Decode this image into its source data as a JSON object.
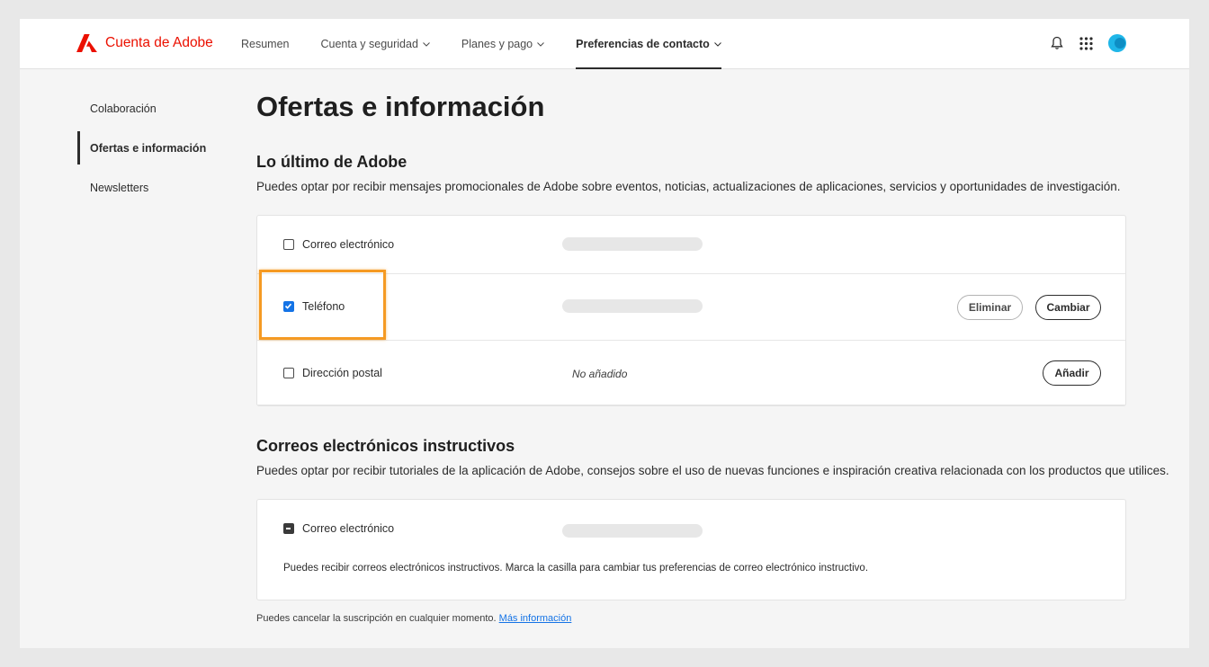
{
  "header": {
    "brand": "Cuenta de Adobe",
    "brand_color": "#eb1000",
    "nav": [
      {
        "label": "Resumen",
        "has_dropdown": false,
        "active": false
      },
      {
        "label": "Cuenta y seguridad",
        "has_dropdown": true,
        "active": false
      },
      {
        "label": "Planes y pago",
        "has_dropdown": true,
        "active": false
      },
      {
        "label": "Preferencias de contacto",
        "has_dropdown": true,
        "active": true
      }
    ],
    "icons": [
      "bell-icon",
      "apps-grid-icon",
      "avatar"
    ]
  },
  "sidebar": {
    "items": [
      {
        "label": "Colaboración",
        "active": false
      },
      {
        "label": "Ofertas e información",
        "active": true
      },
      {
        "label": "Newsletters",
        "active": false
      }
    ]
  },
  "main": {
    "title": "Ofertas e información",
    "latest": {
      "title": "Lo último de Adobe",
      "description": "Puedes optar por recibir mensajes promocionales de Adobe sobre eventos, noticias, actualizaciones de aplicaciones, servicios y oportunidades de investigación.",
      "rows": [
        {
          "label": "Correo electrónico",
          "checked": false,
          "value_hidden": true
        },
        {
          "label": "Teléfono",
          "checked": true,
          "value_hidden": true,
          "remove_label": "Eliminar",
          "change_label": "Cambiar",
          "highlighted": true
        },
        {
          "label": "Dirección postal",
          "checked": false,
          "value": "No añadido",
          "add_label": "Añadir"
        }
      ]
    },
    "instructional": {
      "title": "Correos electrónicos instructivos",
      "description": "Puedes optar por recibir tutoriales de la aplicación de Adobe, consejos sobre el uso de nuevas funciones e inspiración creativa relacionada con los productos que utilices.",
      "row": {
        "label": "Correo electrónico",
        "state": "indeterminate",
        "value_hidden": true
      },
      "info": "Puedes recibir correos electrónicos instructivos. Marca la casilla para cambiar tus preferencias de correo electrónico instructivo."
    },
    "footer": {
      "text": "Puedes cancelar la suscripción en cualquier momento.",
      "link": "Más información",
      "link_color": "#1473e6"
    },
    "highlight_color": "#f59a23",
    "checkbox_color": "#1473e6"
  }
}
